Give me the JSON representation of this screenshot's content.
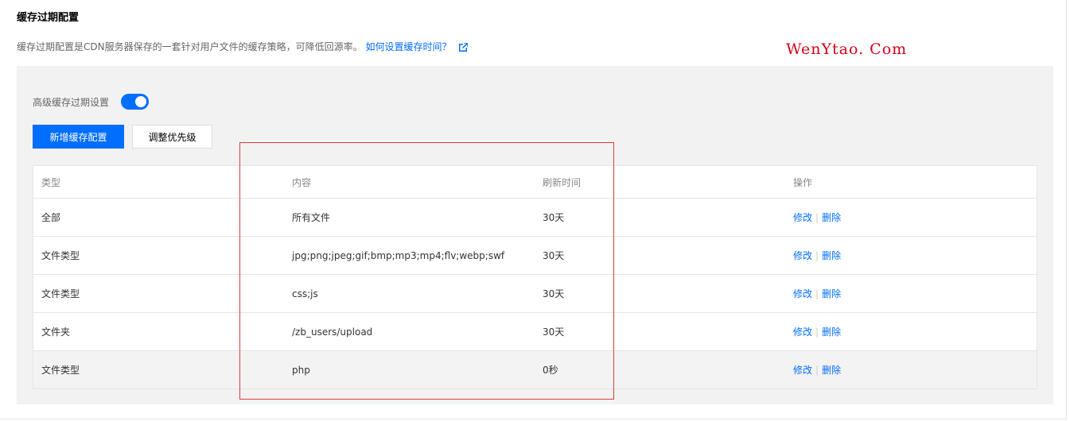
{
  "header": {
    "title": "缓存过期配置",
    "description": "缓存过期配置是CDN服务器保存的一套针对用户文件的缓存策略，可降低回源率。",
    "help_link": "如何设置缓存时间？",
    "help_icon": "external-link-icon"
  },
  "watermark": "WenYtao. Com",
  "advanced": {
    "label": "高级缓存过期设置",
    "enabled": true
  },
  "toolbar": {
    "add_label": "新增缓存配置",
    "priority_label": "调整优先级"
  },
  "table": {
    "columns": [
      "类型",
      "内容",
      "刷新时间",
      "操作"
    ],
    "rows": [
      {
        "type": "全部",
        "content": "所有文件",
        "refresh": "30天",
        "edit": "修改",
        "delete": "删除"
      },
      {
        "type": "文件类型",
        "content": "jpg;png;jpeg;gif;bmp;mp3;mp4;flv;webp;swf",
        "refresh": "30天",
        "edit": "修改",
        "delete": "删除"
      },
      {
        "type": "文件类型",
        "content": "css;js",
        "refresh": "30天",
        "edit": "修改",
        "delete": "删除"
      },
      {
        "type": "文件夹",
        "content": "/zb_users/upload",
        "refresh": "30天",
        "edit": "修改",
        "delete": "删除"
      },
      {
        "type": "文件类型",
        "content": "php",
        "refresh": "0秒",
        "edit": "修改",
        "delete": "删除"
      }
    ]
  },
  "colors": {
    "accent": "#006eff",
    "highlight_box": "#e03b3b",
    "watermark": "#d0021b"
  }
}
